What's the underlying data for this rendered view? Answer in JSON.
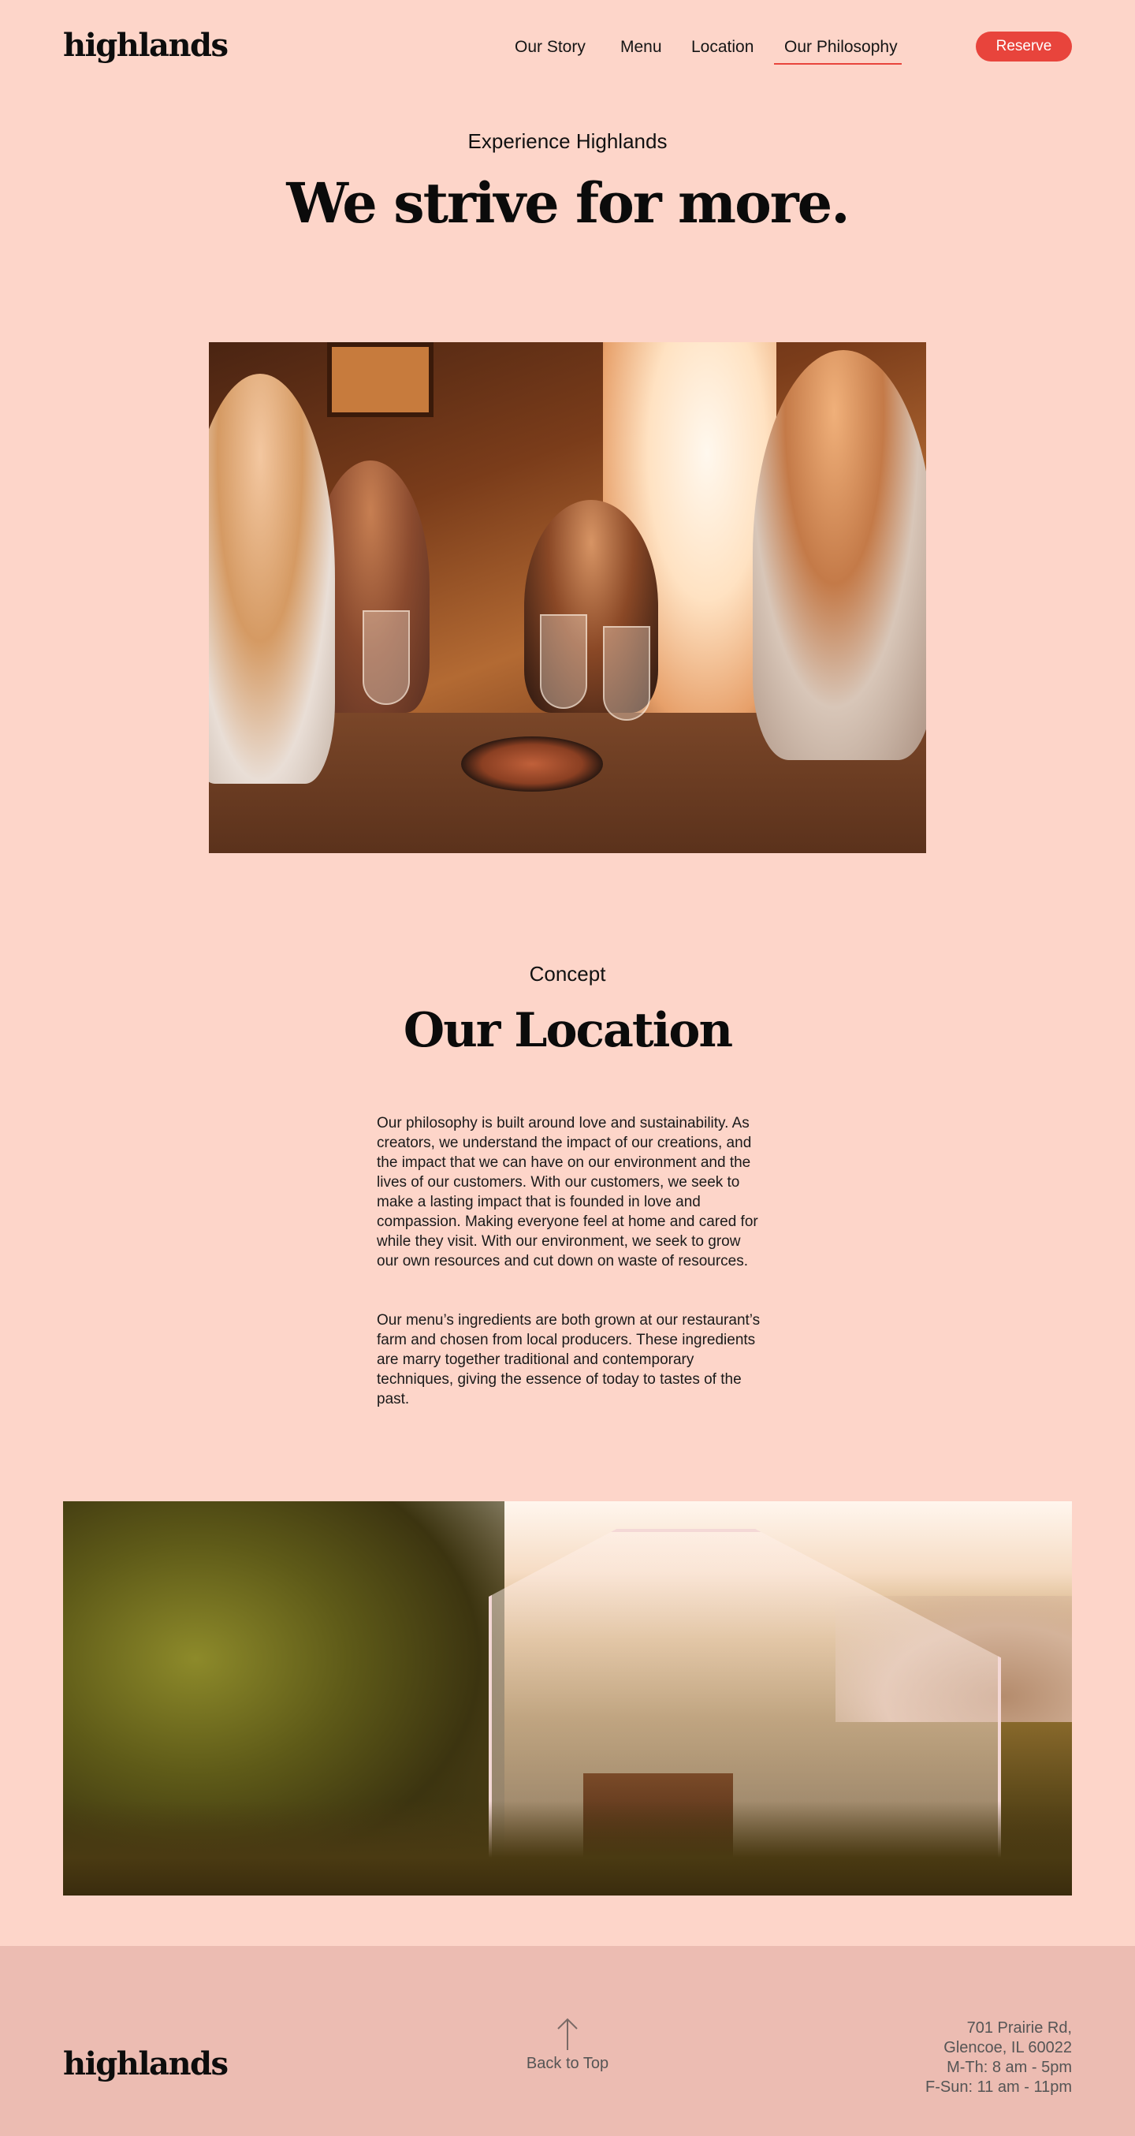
{
  "header": {
    "logo": "highlands",
    "nav": [
      {
        "label": "Our Story"
      },
      {
        "label": "Menu"
      },
      {
        "label": "Location"
      },
      {
        "label": "Our Philosophy",
        "active": true
      }
    ],
    "reserve_label": "Reserve"
  },
  "hero": {
    "eyebrow": "Experience Highlands",
    "title": "We strive for more."
  },
  "concept": {
    "eyebrow": "Concept",
    "title": "Our Location",
    "paragraphs": [
      "Our philosophy is built around love and sustainability. As creators, we understand the impact of our creations, and the impact that we can have on our environment and the lives of our customers. With our customers, we seek to make a lasting impact that is founded in love and compassion. Making everyone feel at home and cared for while they visit. With our environment, we seek to grow our own resources and cut down on waste of resources.",
      "Our menu’s ingredients are both grown at our restaurant’s farm and chosen from local producers. These ingredients are marry together traditional and contemporary techniques, giving the essence of today to tastes of the past."
    ]
  },
  "footer": {
    "logo": "highlands",
    "back_to_top": "Back to Top",
    "address_lines": [
      "701 Prairie Rd,",
      "Glencoe, IL 60022",
      "M-Th: 8 am - 5pm",
      "F-Sun: 11 am - 11pm"
    ]
  },
  "colors": {
    "background": "#fdd5c9",
    "accent": "#e8443c",
    "footer_background": "#ecbcb2"
  },
  "icons": {
    "back_to_top": "arrow-up-icon"
  }
}
